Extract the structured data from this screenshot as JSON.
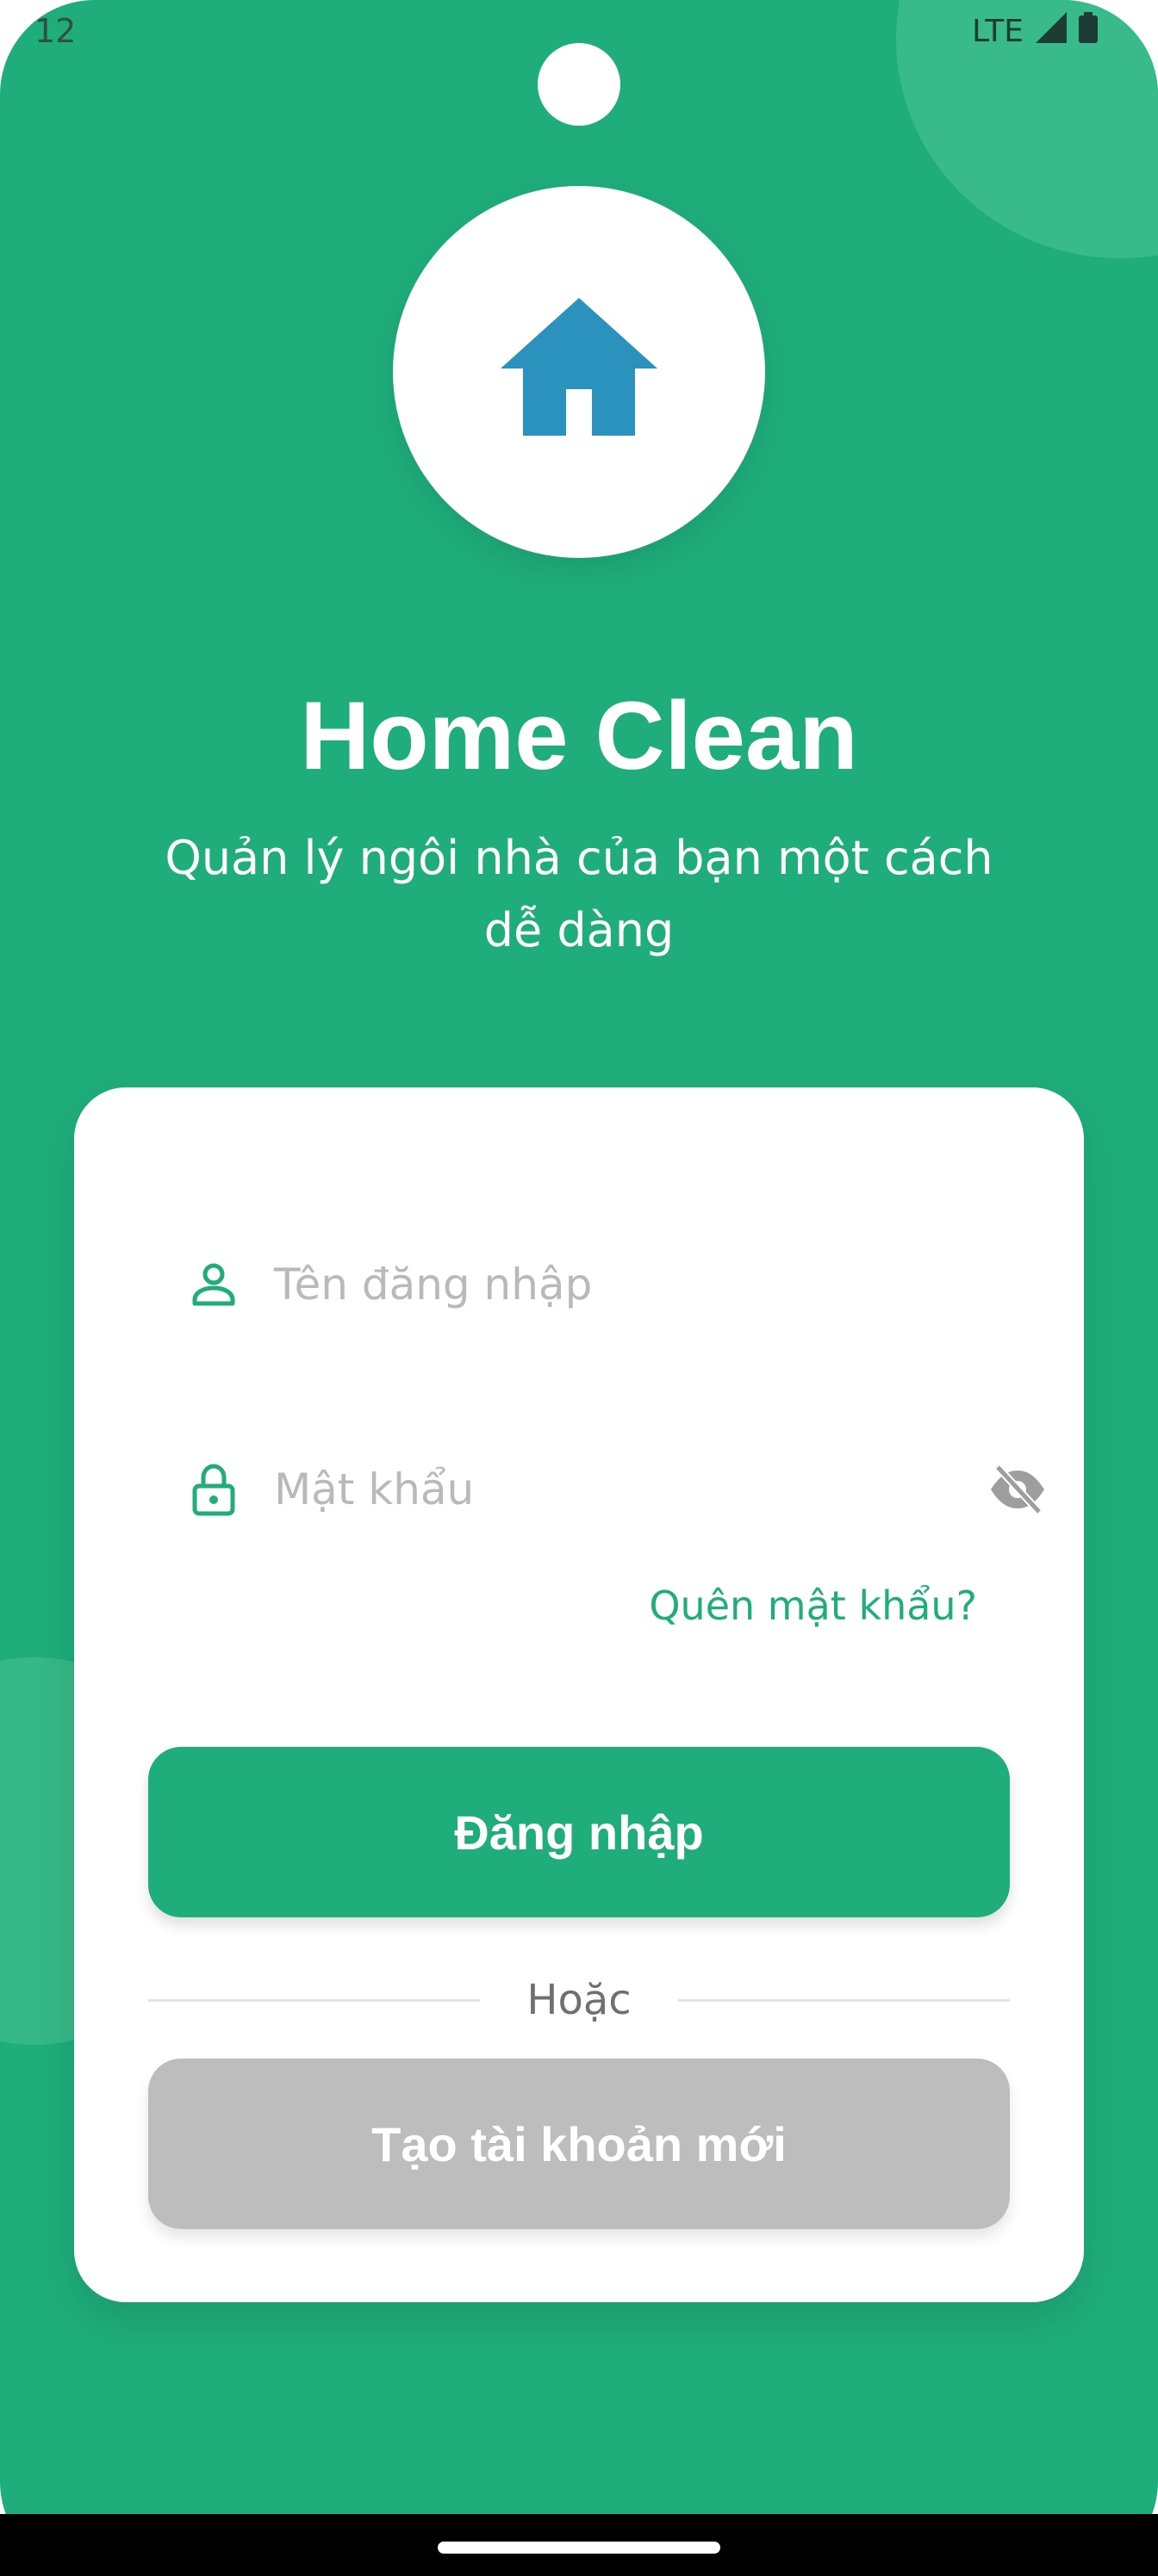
{
  "status_bar": {
    "time": "12",
    "network": "LTE",
    "icons": [
      "signal-icon",
      "battery-icon"
    ]
  },
  "branding": {
    "logo_icon": "house-icon",
    "title": "Home Clean",
    "subtitle": "Quản lý ngôi nhà của bạn một cách dễ dàng"
  },
  "login_form": {
    "username": {
      "placeholder": "Tên đăng nhập",
      "value": "",
      "icon": "person-icon"
    },
    "password": {
      "placeholder": "Mật khẩu",
      "value": "",
      "icon": "lock-icon",
      "toggle_icon": "eye-off-icon"
    },
    "forgot_password": "Quên mật khẩu?",
    "login_button": "Đăng nhập",
    "divider_text": "Hoặc",
    "register_button": "Tạo tài khoản mới"
  },
  "colors": {
    "primary": "#1fae7b",
    "logo_blue": "#2a92bd",
    "disabled": "#bdbdbd",
    "placeholder": "#b9b9b9"
  }
}
